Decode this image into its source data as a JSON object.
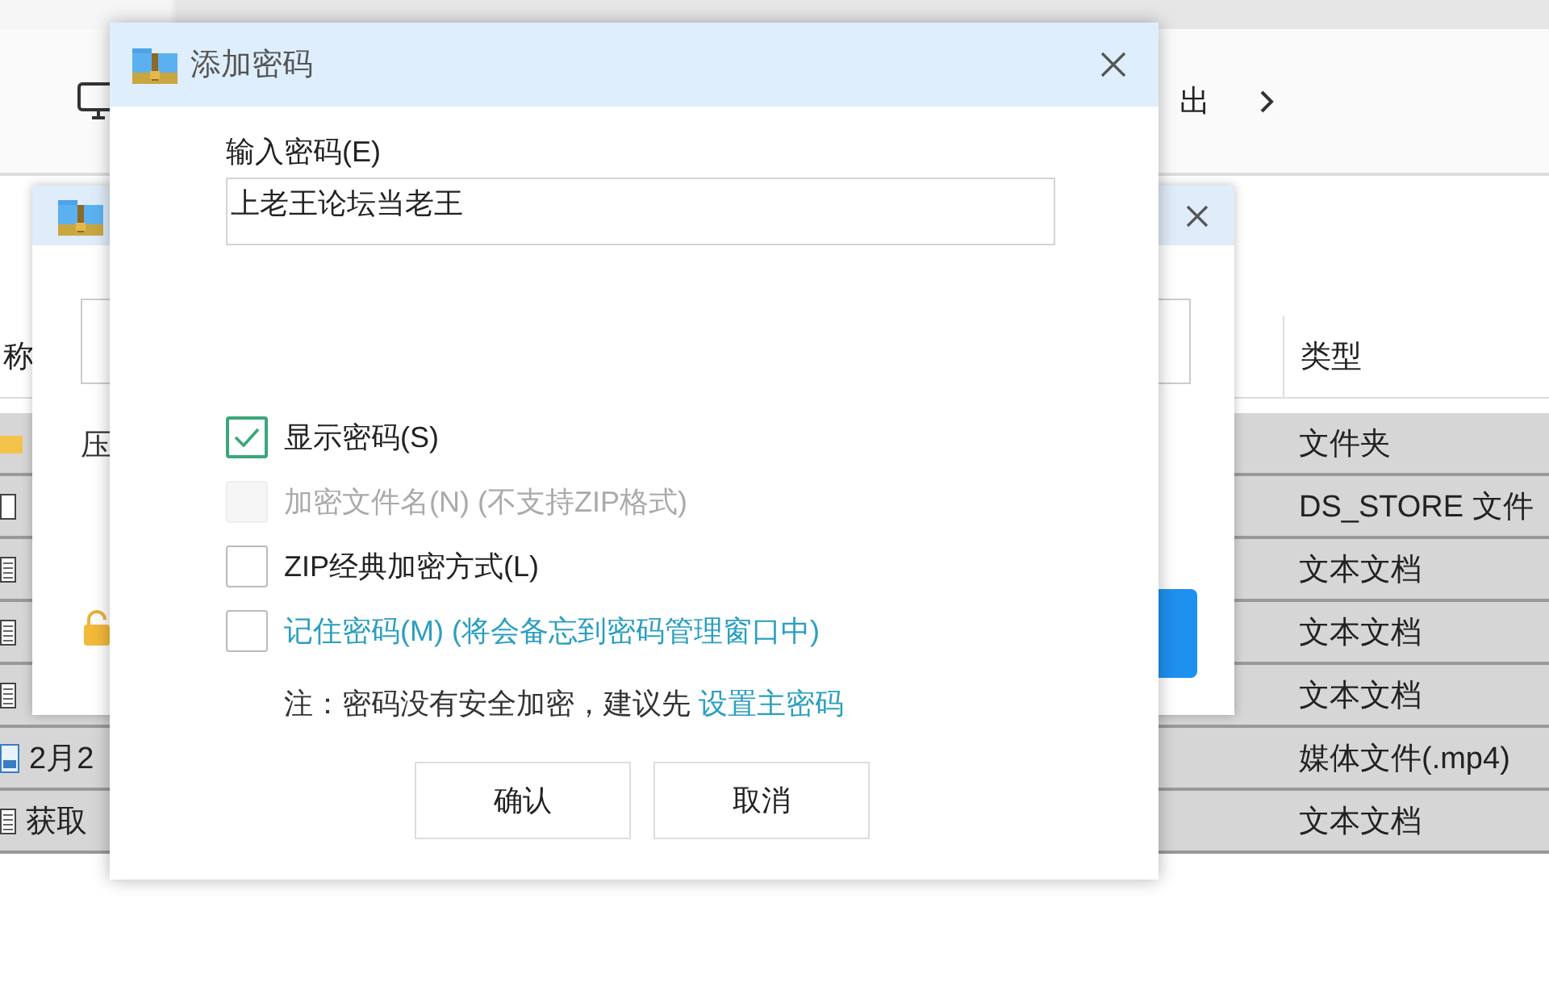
{
  "explorer": {
    "toolbar_text": "出",
    "columns": [
      {
        "label": "称"
      },
      {
        "label": "类型"
      }
    ],
    "rows": [
      {
        "kind": "folder",
        "selected": true,
        "type": "文件夹"
      },
      {
        "kind": "file",
        "selected": true,
        "type": "DS_STORE 文件"
      },
      {
        "kind": "text",
        "selected": true,
        "type": "文本文档"
      },
      {
        "kind": "text",
        "selected": true,
        "type": "文本文档"
      },
      {
        "kind": "text",
        "selected": true,
        "type": "文本文档"
      },
      {
        "kind": "video",
        "selected": true,
        "name": "2月2",
        "type": "媒体文件(.mp4)"
      },
      {
        "kind": "text",
        "selected": true,
        "name": "获取",
        "type": "文本文档"
      }
    ]
  },
  "compress_dialog": {
    "label": "压"
  },
  "password_dialog": {
    "title": "添加密码",
    "field_label": "输入密码(E)",
    "value": "上老王论坛当老王",
    "options": [
      {
        "label": "显示密码(S)",
        "checked": true,
        "disabled": false,
        "link": false
      },
      {
        "label": "加密文件名(N) (不支持ZIP格式)",
        "checked": false,
        "disabled": true,
        "link": false
      },
      {
        "label": "ZIP经典加密方式(L)",
        "checked": false,
        "disabled": false,
        "link": false
      },
      {
        "label": "记住密码(M) (将会备忘到密码管理窗口中)",
        "checked": false,
        "disabled": false,
        "link": true
      }
    ],
    "note": "注：密码没有安全加密，建议先",
    "note_link": "设置主密码",
    "buttons": [
      "确认",
      "取消"
    ]
  }
}
